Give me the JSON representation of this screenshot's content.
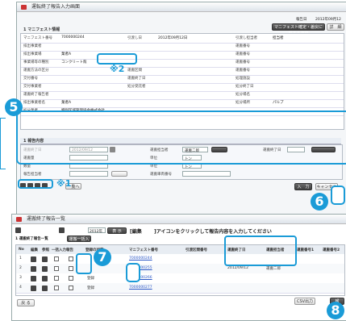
{
  "top_window": {
    "title": "運転終了報告入力画面",
    "meta_label": "報告日",
    "meta_value": "2012年09月12",
    "manifest_btn": "マニフェスト確定・差戻に関する連絡",
    "detail_btn": "詳　細",
    "section_title": "1 マニフェスト情報",
    "labels_left": [
      "マニフェスト番号",
      "排出事業者",
      "排出事業場",
      "事業場等の種別",
      "運搬方法の区分",
      "交付番号",
      "交付事業者",
      "運搬終了報告者",
      "排出事業者名",
      "処分業者"
    ],
    "values_left": [
      "7000000244",
      "",
      "業者A",
      "コンクリート殻",
      "",
      "",
      "",
      "",
      "業者A",
      "特別区域管理協会株式会社"
    ],
    "labels_mid": [
      "引渡し日",
      "",
      "",
      "",
      "運搬区間",
      "運搬終了日",
      "処分受託者"
    ],
    "values_mid": [
      "2012年09月12日"
    ],
    "labels_right": [
      "引渡し担当者",
      "運搬番号",
      "運搬番号",
      "運搬番号",
      "運搬番号",
      "処理施設",
      "処分終了日",
      "処分場名",
      "処分場所"
    ],
    "values_right": [
      "担当者",
      "",
      "",
      "",
      "",
      "",
      "",
      "",
      "パルプ"
    ],
    "input_section": "1 報告内容",
    "form_labels": [
      "運搬終了日",
      "運搬量",
      "数量",
      "報告担当者",
      "運搬担当者",
      "単位",
      "運搬車両番号",
      "運搬終了日"
    ],
    "form_values": [
      "2012/09/12",
      "運搬二郎",
      "運搬二郎",
      "トン",
      "トン",
      ""
    ],
    "list_btn": "一覧へ",
    "ok_btn": "入　力",
    "cancel_btn": "キャンセル",
    "note1": "※1",
    "note2": "※2"
  },
  "bottom_window": {
    "title": "運搬終了報告一覧",
    "filter_text": "[編集",
    "filter_text2": "]アイコンをクリックして報告内容を入力してください",
    "filter_date": "2012年",
    "search_btn": "表 示",
    "sub_title": "1 運搬終了報告一覧",
    "sub_btn": "運搬一括入力",
    "headers": [
      "No",
      "編集",
      "参照",
      "一括入力",
      "報告",
      "登録の状態",
      "マニフェスト番号",
      "引渡区間番号",
      "運搬終了日",
      "運搬担当者",
      "運搬番号1",
      "運搬番号2"
    ],
    "rows": [
      {
        "no": "1",
        "status": "",
        "manifest": "7000000244",
        "date": "",
        "person": ""
      },
      {
        "no": "2",
        "status": "",
        "manifest": "7000000255",
        "date": "2012/09/12",
        "person": "運搬二郎"
      },
      {
        "no": "3",
        "status": "登録",
        "manifest": "7000000266",
        "date": "",
        "person": ""
      },
      {
        "no": "4",
        "status": "登録",
        "manifest": "7000000277",
        "date": "",
        "person": ""
      }
    ],
    "back_btn": "戻 る",
    "csv_btn": "CSV出力",
    "report_btn": "報"
  },
  "callouts": {
    "c5": "5",
    "c6": "6",
    "c7": "7",
    "c8": "8"
  },
  "colors": {
    "accent": "#1a9bd7"
  }
}
